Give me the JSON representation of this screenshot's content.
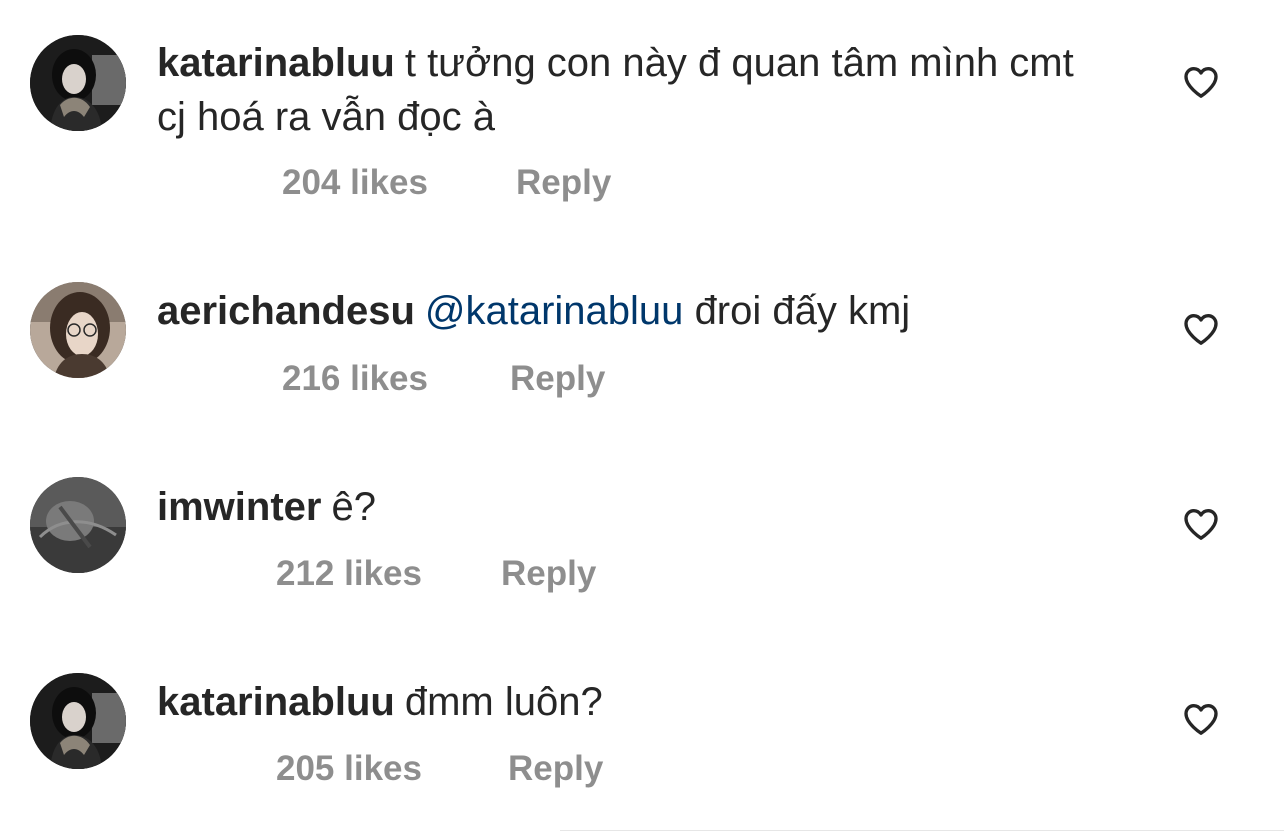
{
  "comments": [
    {
      "username": "katarinabluu",
      "text": "t tưởng con này đ quan tâm mình cmt cj hoá ra vẫn đọc à",
      "likes": "204 likes",
      "reply": "Reply",
      "avatar": "katarinabluu-avatar"
    },
    {
      "username": "aerichandesu",
      "mention": "@katarinabluu",
      "text": "đroi đấy kmj",
      "likes": "216 likes",
      "reply": "Reply",
      "avatar": "aerichandesu-avatar"
    },
    {
      "username": "imwinter",
      "text": "ê?",
      "likes": "212 likes",
      "reply": "Reply",
      "avatar": "imwinter-avatar"
    },
    {
      "username": "katarinabluu",
      "text": "đmm luôn?",
      "likes": "205 likes",
      "reply": "Reply",
      "avatar": "katarinabluu-avatar"
    }
  ],
  "icons": {
    "like": "heart-outline-icon"
  },
  "colors": {
    "text": "#262626",
    "meta": "#8e8e8e",
    "mention": "#00376b",
    "icon": "#262626"
  }
}
